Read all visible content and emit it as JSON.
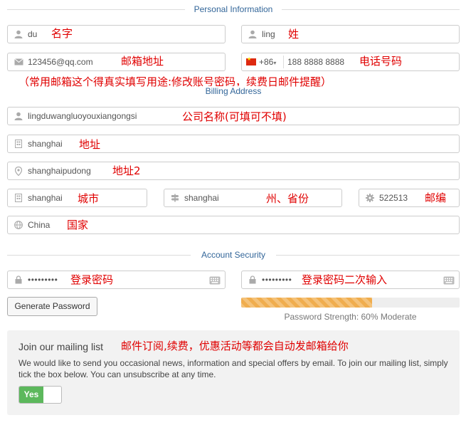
{
  "sections": {
    "personal": "Personal Information",
    "billing": "Billing Address",
    "security": "Account Security"
  },
  "fields": {
    "first_name": {
      "value": "du",
      "icon": "user-icon"
    },
    "last_name": {
      "value": "ling",
      "icon": "user-icon"
    },
    "email": {
      "value": "123456@qq.com",
      "icon": "envelope-icon"
    },
    "phone": {
      "country_code": "+86",
      "value": "188 8888 8888",
      "flag": "china-flag-icon"
    },
    "company": {
      "value": "lingduwangluoyouxiangongsi",
      "icon": "user-icon"
    },
    "address1": {
      "value": "shanghai",
      "icon": "building-icon"
    },
    "address2": {
      "value": "shanghaipudong",
      "icon": "map-marker-icon"
    },
    "city": {
      "value": "shanghai",
      "icon": "building-icon"
    },
    "state": {
      "value": "shanghai",
      "icon": "signpost-icon"
    },
    "postcode": {
      "value": "522513",
      "icon": "cog-icon"
    },
    "country": {
      "value": "China",
      "icon": "globe-icon"
    },
    "password": {
      "value": "•••••••••",
      "icon": "lock-icon"
    },
    "password_confirm": {
      "value": "•••••••••",
      "icon": "lock-icon"
    }
  },
  "annotations": {
    "first_name": "名字",
    "last_name": "姓",
    "email": "邮箱地址",
    "phone": "电话号码",
    "email_note": "（常用邮箱这个得真实填写用途:修改账号密码，续费日邮件提醒）",
    "company": "公司名称(可填可不填)",
    "address1": "地址",
    "address2": "地址2",
    "city": "城市",
    "state": "州、省份",
    "postcode": "邮编",
    "country": "国家",
    "password": "登录密码",
    "password_confirm": "登录密码二次输入",
    "mailing": "邮件订阅,续费，优惠活动等都会自动发邮箱给你"
  },
  "security": {
    "generate_label": "Generate Password",
    "strength_percent": 60,
    "strength_text": "Password Strength: 60% Moderate",
    "strength_color": "#f0ad4e"
  },
  "mailing": {
    "title": "Join our mailing list",
    "description": "We would like to send you occasional news, information and special offers by email. To join our mailing list, simply tick the box below. You can unsubscribe at any time.",
    "toggle_label": "Yes",
    "toggle_on": true,
    "toggle_color": "#5cb85c"
  },
  "colors": {
    "section_title": "#336699",
    "annotation": "#e00000"
  }
}
